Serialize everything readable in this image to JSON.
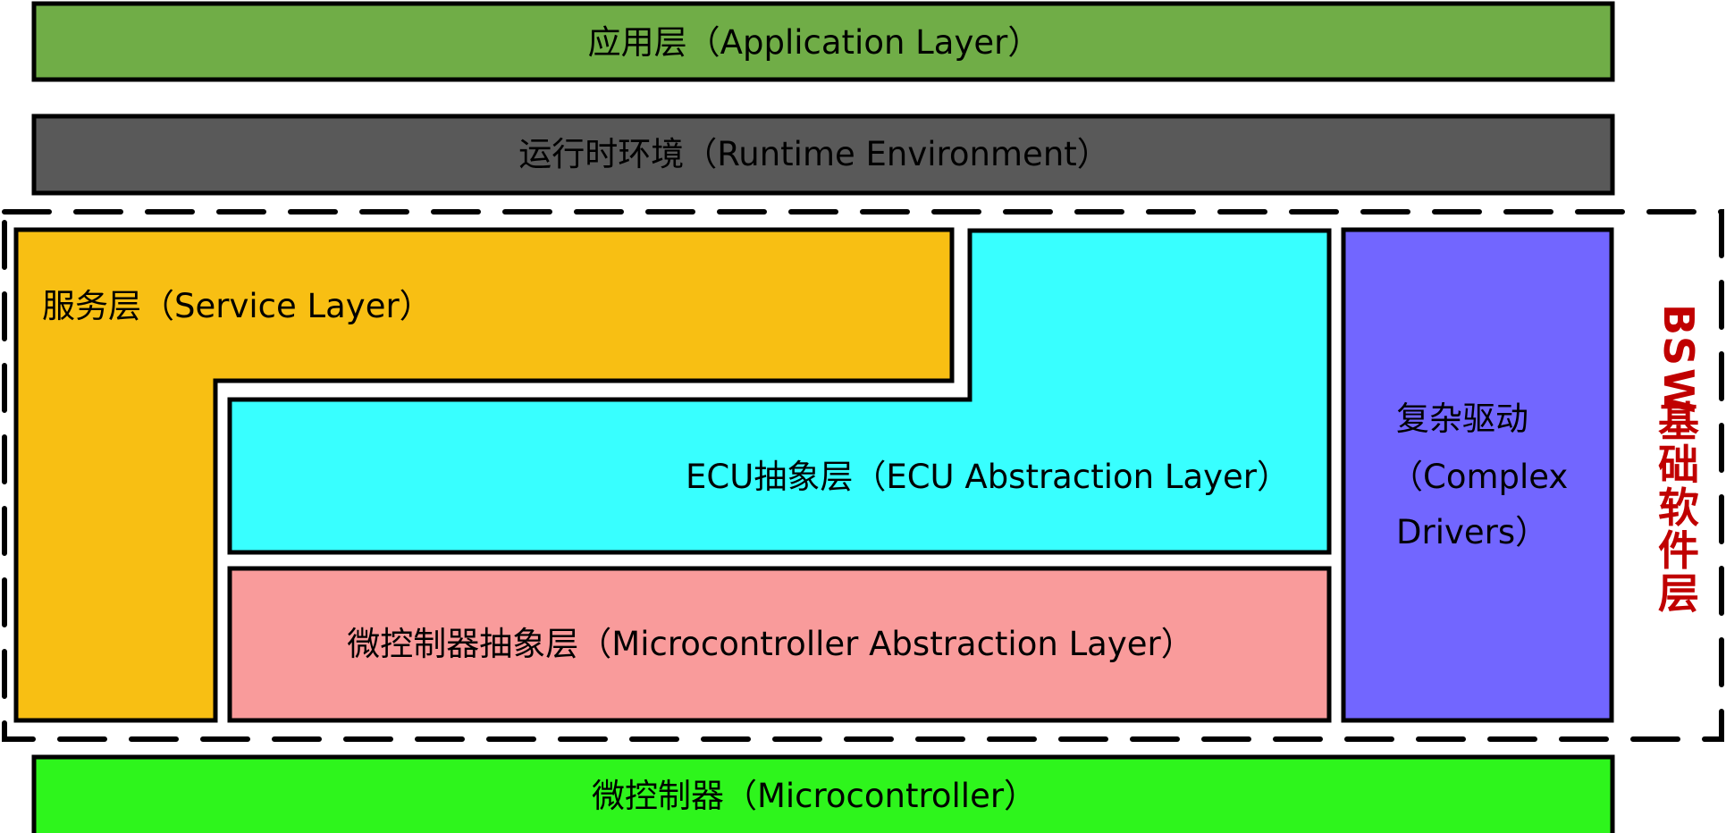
{
  "layers": {
    "application": {
      "label": "应用层（Application Layer）",
      "color": "#70AD47"
    },
    "rte": {
      "label": "运行时环境（Runtime Environment）",
      "color": "#595959"
    },
    "service": {
      "label": "服务层（Service Layer）",
      "color": "#F8BF13"
    },
    "ecu_abstraction": {
      "label": "ECU抽象层（ECU Abstraction Layer）",
      "color": "#38FFFF"
    },
    "mcal": {
      "label": "微控制器抽象层（Microcontroller Abstraction Layer）",
      "color": "#F99B9B"
    },
    "complex_drivers": {
      "line1": "复杂驱动",
      "line2": "（Complex",
      "line3": "Drivers）",
      "color": "#7266FF"
    },
    "microcontroller": {
      "label": "微控制器（Microcontroller）",
      "color": "#2EF51C"
    }
  },
  "bsw_group": {
    "label_chars": [
      "B",
      "S",
      "W",
      "基",
      "础",
      "软",
      "件",
      "层"
    ],
    "label": "BSW基础软件层",
    "color": "#C00000"
  }
}
